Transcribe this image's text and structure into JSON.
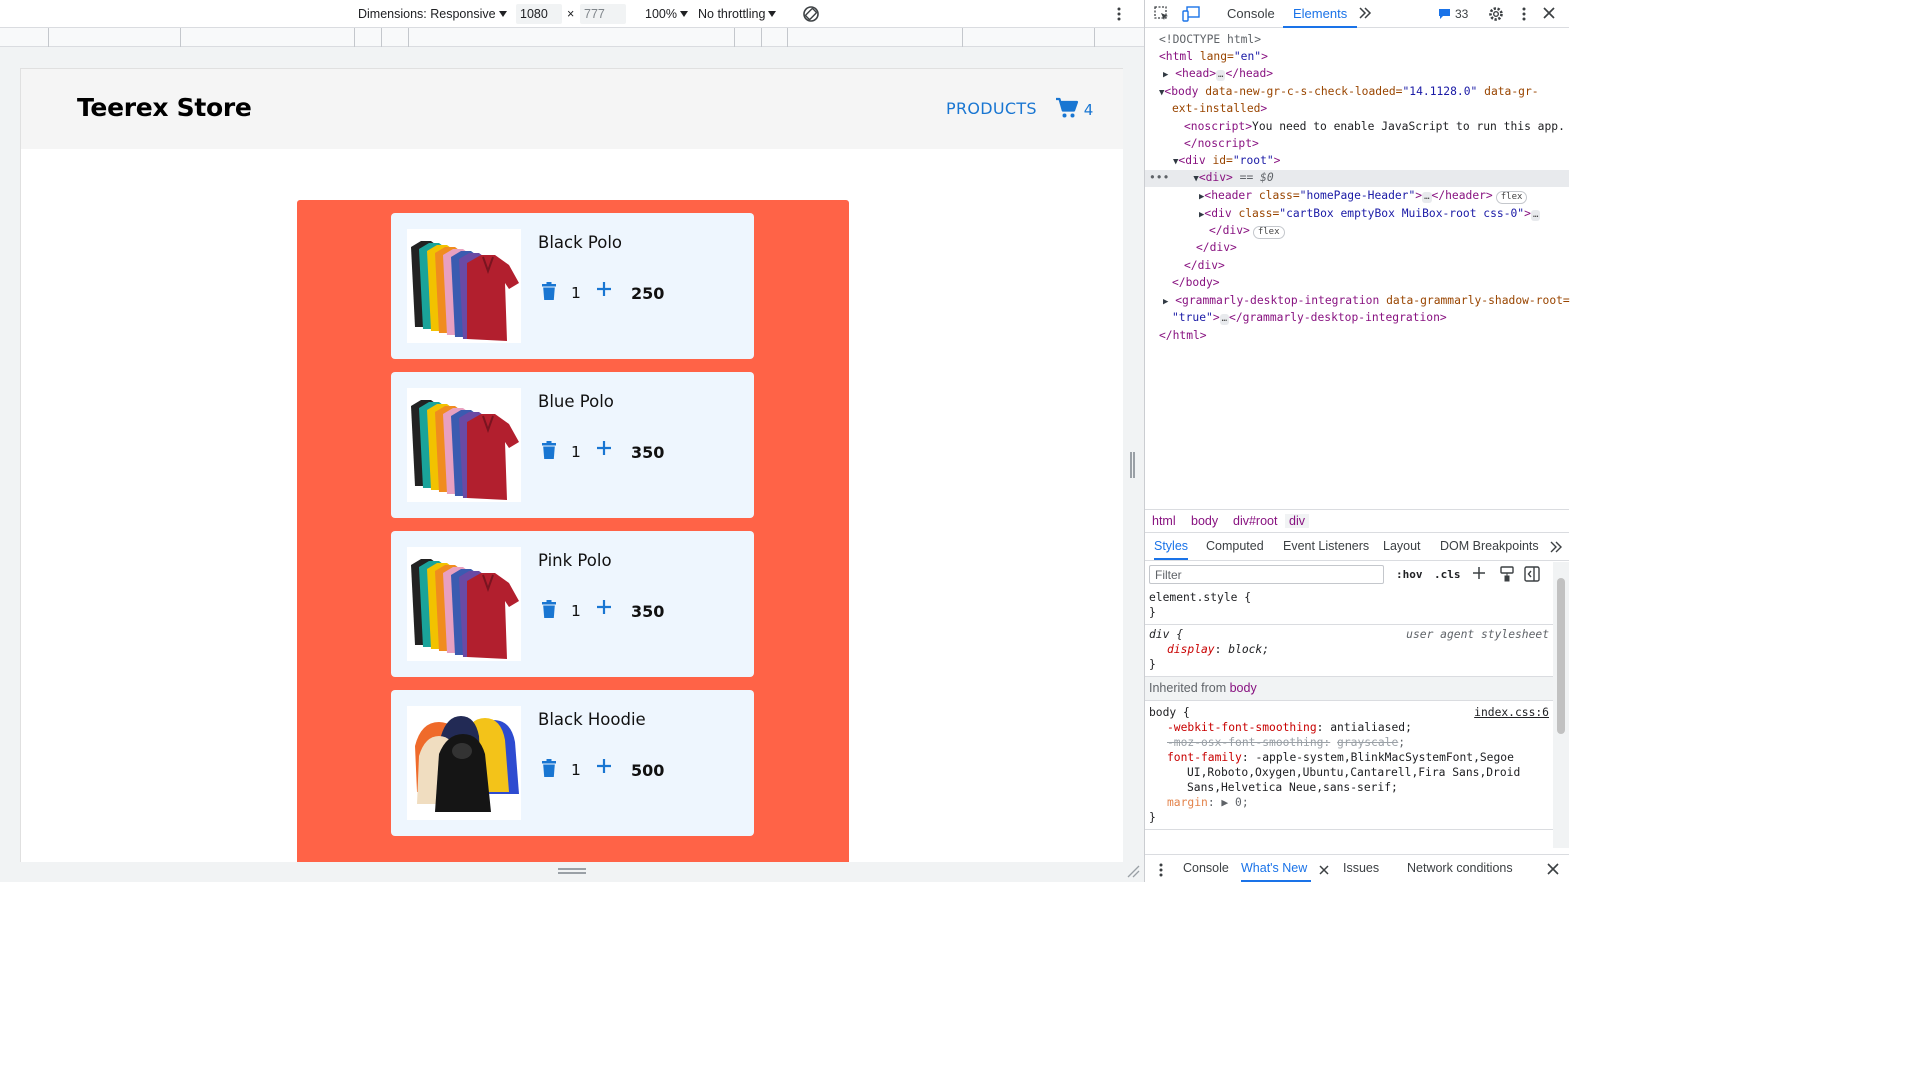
{
  "device_toolbar": {
    "dimensions_label": "Dimensions: Responsive",
    "width_value": "1080",
    "times": "×",
    "height_placeholder": "777",
    "zoom": "100%",
    "throttling": "No throttling"
  },
  "app": {
    "brand": "Teerex Store",
    "nav_products": "PRODUCTS",
    "cart_count": "4",
    "items": [
      {
        "name": "Black Polo",
        "qty": "1",
        "price": "250",
        "image": "polo-shirts-image"
      },
      {
        "name": "Blue Polo",
        "qty": "1",
        "price": "350",
        "image": "polo-shirts-image"
      },
      {
        "name": "Pink Polo",
        "qty": "1",
        "price": "350",
        "image": "polo-shirts-image"
      },
      {
        "name": "Black Hoodie",
        "qty": "1",
        "price": "500",
        "image": "hoodies-image"
      }
    ]
  },
  "devtools": {
    "tabs": {
      "console": "Console",
      "elements": "Elements"
    },
    "issues_count": "33",
    "dom": {
      "doctype": "<!DOCTYPE html>",
      "html_open_tag": "<html",
      "html_lang_attr": "lang=",
      "html_lang_val": "\"en\"",
      "head": "<head>",
      "head_close": "</head>",
      "body_tag": "<body",
      "body_attr1": "data-new-gr-c-s-check-loaded=",
      "body_val1": "\"14.1128.0\"",
      "body_attr2": "data-gr-",
      "body_attr2b": "ext-installed",
      "noscript_open": "<noscript>",
      "noscript_text": "You need to enable JavaScript to run this app.",
      "noscript_close": "</noscript>",
      "root_div": "<div",
      "root_attr": "id=",
      "root_val": "\"root\"",
      "div_sel": "<div>",
      "div_sel_eq": "== $0",
      "header_tag": "<header",
      "header_attr": "class=",
      "header_val": "\"homePage-Header\"",
      "header_close": "</header>",
      "cartbox_tag": "<div",
      "cartbox_attr": "class=",
      "cartbox_val": "\"cartBox emptyBox MuiBox-root css-0\"",
      "div_close": "</div>",
      "body_close": "</body>",
      "grammarly_open": "<grammarly-desktop-integration",
      "grammarly_attr": "data-grammarly-shadow-root=",
      "grammarly_val": "\"true\"",
      "grammarly_close": "</grammarly-desktop-integration>",
      "html_close": "</html>",
      "flex": "flex",
      "ellipsis": "…"
    },
    "breadcrumbs": [
      "html",
      "body",
      "div#root",
      "div"
    ],
    "style_tabs": [
      "Styles",
      "Computed",
      "Event Listeners",
      "Layout",
      "DOM Breakpoints"
    ],
    "filter_placeholder": "Filter",
    "hov": ":hov",
    "cls": ".cls",
    "styles": {
      "element_style": "element.style {",
      "close": "}",
      "div_sel": "div {",
      "ua": "user agent stylesheet",
      "display_prop": "display",
      "display_val": "block;",
      "inherited_label": "Inherited from",
      "inherited_from": "body",
      "body_sel": "body {",
      "source": "index.css:6",
      "p1": "-webkit-font-smoothing",
      "v1": "antialiased;",
      "p2": "-moz-osx-font-smoothing:",
      "v2": "grayscale",
      "p3": "font-family",
      "v3a": "-apple-system,BlinkMacSystemFont,Segoe",
      "v3b": "UI,Roboto,Oxygen,Ubuntu,Cantarell,Fira Sans,Droid",
      "v3c": "Sans,Helvetica Neue,sans-serif;",
      "p4": "margin",
      "v4": "0;"
    },
    "drawer": {
      "console": "Console",
      "whats_new": "What's New",
      "issues": "Issues",
      "network": "Network conditions"
    }
  }
}
